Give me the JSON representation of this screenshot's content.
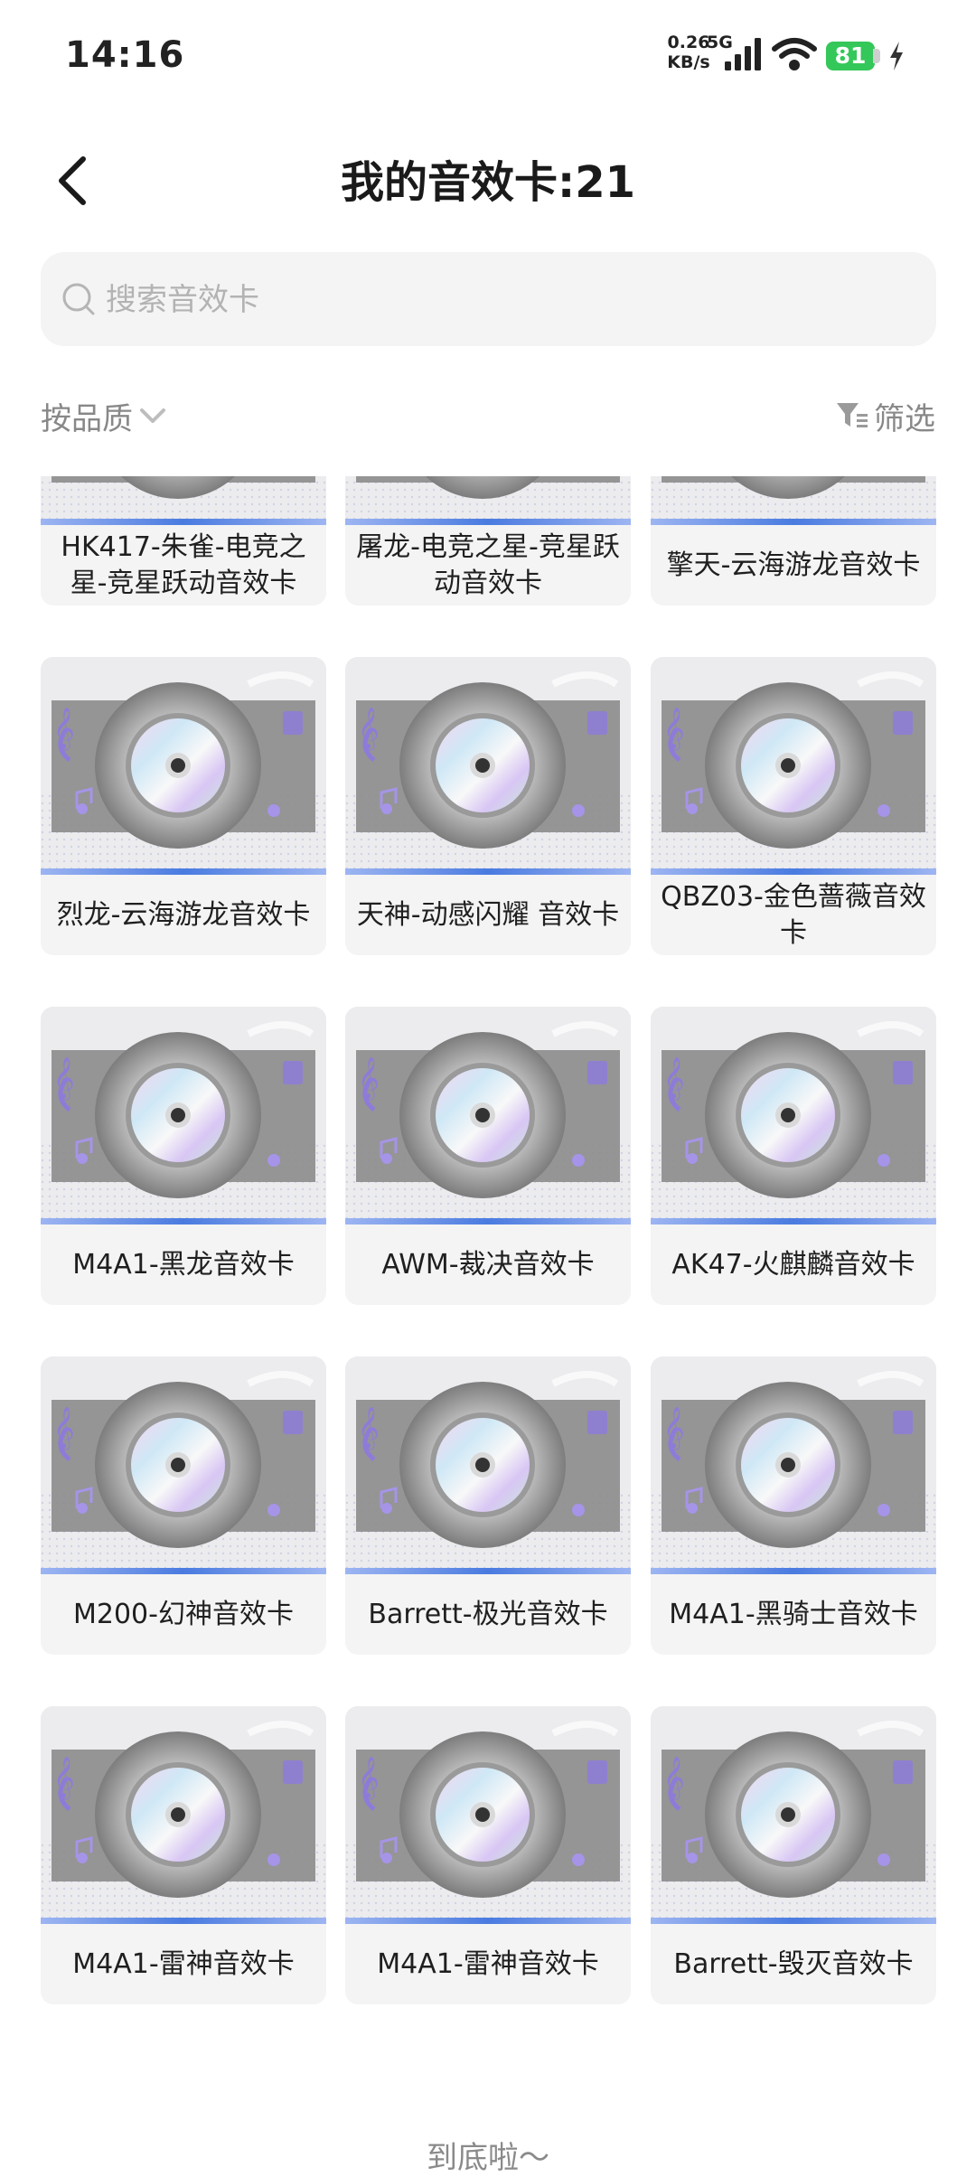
{
  "status_bar": {
    "time": "14:16",
    "net_speed_value": "0.26",
    "net_speed_unit": "KB/s",
    "network_type": "5G",
    "battery_level": "81",
    "battery_color": "#34c759"
  },
  "header": {
    "title": "我的音效卡:21"
  },
  "search": {
    "placeholder": "搜索音效卡"
  },
  "toolbar": {
    "sort_label": "按品质",
    "filter_label": "筛选"
  },
  "cards": [
    {
      "name": "HK417-朱雀-电竞之星-竞星跃动音效卡"
    },
    {
      "name": "屠龙-电竞之星-竞星跃动音效卡"
    },
    {
      "name": "擎天-云海游龙音效卡"
    },
    {
      "name": "烈龙-云海游龙音效卡"
    },
    {
      "name": "天神-动感闪耀 音效卡"
    },
    {
      "name": "QBZ03-金色蔷薇音效卡"
    },
    {
      "name": "M4A1-黑龙音效卡"
    },
    {
      "name": "AWM-裁决音效卡"
    },
    {
      "name": "AK47-火麒麟音效卡"
    },
    {
      "name": "M200-幻神音效卡"
    },
    {
      "name": "Barrett-极光音效卡"
    },
    {
      "name": "M4A1-黑骑士音效卡"
    },
    {
      "name": "M4A1-雷神音效卡"
    },
    {
      "name": "M4A1-雷神音效卡"
    },
    {
      "name": "Barrett-毁灭音效卡"
    }
  ],
  "footer": {
    "end_text": "到底啦～"
  },
  "colors": {
    "accent_bar": "#4a7be0",
    "card_bg": "#f4f4f4"
  }
}
